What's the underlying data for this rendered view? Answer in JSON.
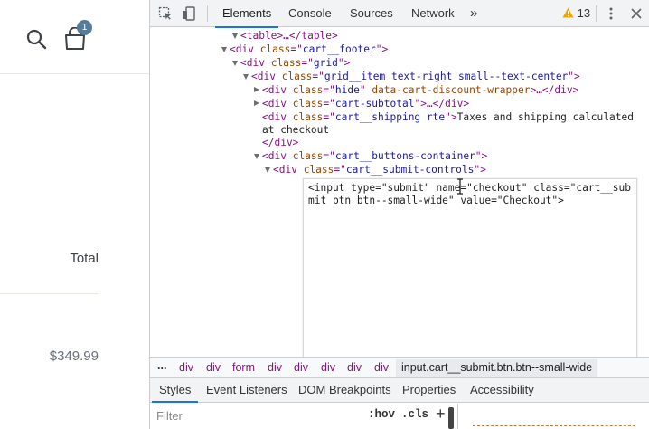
{
  "site": {
    "cart_count": "1",
    "total_label": "Total",
    "price": "$349.99",
    "icons": [
      "search-icon",
      "cart-icon"
    ]
  },
  "devtools": {
    "tabs": [
      "Elements",
      "Console",
      "Sources",
      "Network",
      "»"
    ],
    "active_tab": "Elements",
    "warnings_count": "13",
    "icons": [
      "inspect-icon",
      "device-toggle-icon",
      "warning-icon",
      "kebab-menu-icon",
      "close-icon"
    ],
    "tree": [
      {
        "open": true,
        "t": "<table>",
        "tail": "…</table>"
      },
      {
        "open": true,
        "t": "<div",
        "attrs": [
          [
            "class",
            "cart__footer"
          ]
        ],
        "tail": ">"
      },
      {
        "open": true,
        "t": "<div",
        "attrs": [
          [
            "class",
            "grid"
          ]
        ],
        "tail": ">"
      },
      {
        "open": true,
        "t": "<div",
        "attrs": [
          [
            "class",
            "grid__item text-right small--text-center"
          ]
        ],
        "tail": ">"
      },
      {
        "open": false,
        "t": "<div",
        "attrs": [
          [
            "class",
            "hide"
          ],
          [
            "data-cart-discount-wrapper",
            ""
          ]
        ],
        "tail": ">…</div>"
      },
      {
        "open": false,
        "t": "<div",
        "attrs": [
          [
            "class",
            "cart-subtotal"
          ]
        ],
        "tail": ">…</div>"
      },
      {
        "open": null,
        "t": "<div",
        "attrs": [
          [
            "class",
            "cart__shipping rte"
          ]
        ],
        "tail": ">",
        "text": "Taxes and shipping calculated"
      },
      {
        "open": null,
        "text": "at checkout"
      },
      {
        "open": null,
        "t": "</div>"
      },
      {
        "open": true,
        "t": "<div",
        "attrs": [
          [
            "class",
            "cart__buttons-container"
          ]
        ],
        "tail": ">"
      },
      {
        "open": true,
        "t": "<div",
        "attrs": [
          [
            "class",
            "cart__submit-controls"
          ]
        ],
        "tail": ">"
      }
    ],
    "edit_html": "<input type=\"submit\" name=\"checkout\" class=\"cart__submit btn btn--small-wide\" value=\"Checkout\">",
    "breadcrumbs": [
      "...",
      "div",
      "div",
      "form",
      "div",
      "div",
      "div",
      "div",
      "div"
    ],
    "breadcrumb_selected": "input.cart__submit.btn.btn--small-wide",
    "panel_tabs": [
      "Styles",
      "Event Listeners",
      "DOM Breakpoints",
      "Properties",
      "Accessibility"
    ],
    "active_panel_tab": "Styles",
    "filter_placeholder": "Filter",
    "hov_label": ":hov",
    "cls_label": ".cls",
    "plus_label": "+"
  },
  "colors": {
    "tag": "#881280",
    "attr_name": "#994500",
    "attr_value": "#1a1aa6",
    "accent": "#1a73e8",
    "badge": "#557b97"
  }
}
